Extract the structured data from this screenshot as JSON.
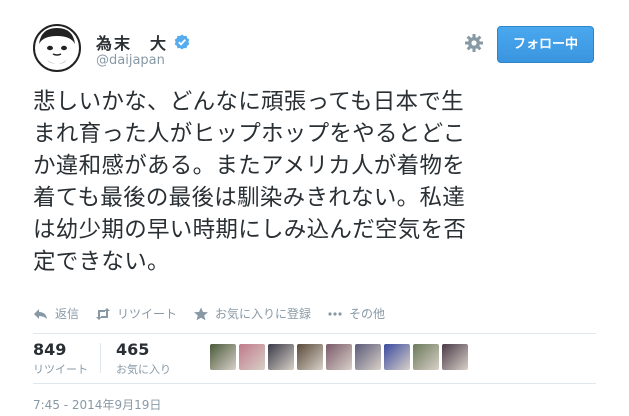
{
  "author": {
    "name": "為末　大",
    "handle": "@daijapan",
    "verified": true
  },
  "follow_button": {
    "label": "フォロー中",
    "color": "#3b97e0"
  },
  "tweet": {
    "lines": [
      "悲しいかな、どんなに頑張っても日本で生",
      "まれ育った人がヒップホップをやるとどこ",
      "か違和感がある。またアメリカ人が着物を",
      "着ても最後の最後は馴染みきれない。私達",
      "は幼少期の早い時期にしみ込んだ空気を否",
      "定できない。"
    ]
  },
  "actions": [
    {
      "icon": "reply-icon",
      "label": "返信"
    },
    {
      "icon": "retweet-icon",
      "label": "リツイート"
    },
    {
      "icon": "star-icon",
      "label": "お気に入りに登録"
    },
    {
      "icon": "more-dots-icon",
      "label": "その他"
    }
  ],
  "stats": {
    "retweets": {
      "count": "849",
      "label": "リツイート"
    },
    "favorites": {
      "count": "465",
      "label": "お気に入り"
    }
  },
  "favoriters": [
    {
      "color": "#4a5a3a"
    },
    {
      "color": "#c07a8a"
    },
    {
      "color": "#3a3a48"
    },
    {
      "color": "#5a4a3a"
    },
    {
      "color": "#7a5a6a"
    },
    {
      "color": "#5a5a78"
    },
    {
      "color": "#3a4aa0"
    },
    {
      "color": "#6a7a5a"
    },
    {
      "color": "#4a3a48"
    }
  ],
  "timestamp": "7:45 - 2014年9月19日"
}
